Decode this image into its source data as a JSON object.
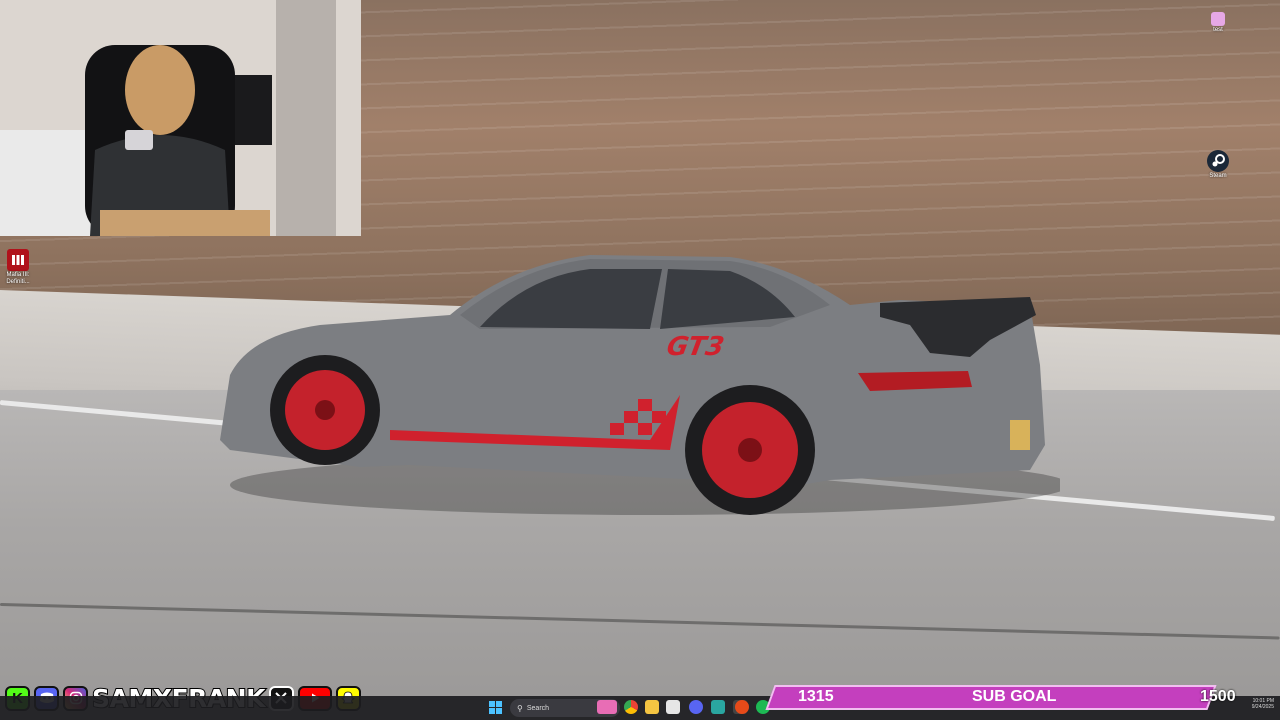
{
  "desktop": {
    "icons": [
      {
        "id": "test",
        "label": "test"
      },
      {
        "id": "steam",
        "label": "Steam"
      },
      {
        "id": "mafia",
        "label": "Mafia III: Definiti..."
      }
    ]
  },
  "overlay": {
    "social": {
      "handle": "SAMXFRANK",
      "platforms": [
        "kick",
        "discord",
        "instagram",
        "x",
        "youtube",
        "snapchat"
      ]
    },
    "sub_goal": {
      "label": "SUB GOAL",
      "current": "1315",
      "target": "1500",
      "progress_fraction": 0.877
    }
  },
  "car": {
    "badge": "GT3"
  },
  "taskbar": {
    "search_placeholder": "Search",
    "clock_time": "10:01 PM",
    "clock_date": "9/24/2025"
  },
  "colors": {
    "sub_goal_bg": "#c43fbe",
    "sub_goal_border": "#f1bff0",
    "car_body": "#7c7e82",
    "car_accent": "#d0212d",
    "kick_green": "#53fc18",
    "discord": "#5865f2",
    "youtube": "#ff0000",
    "snapchat": "#fffc00"
  }
}
